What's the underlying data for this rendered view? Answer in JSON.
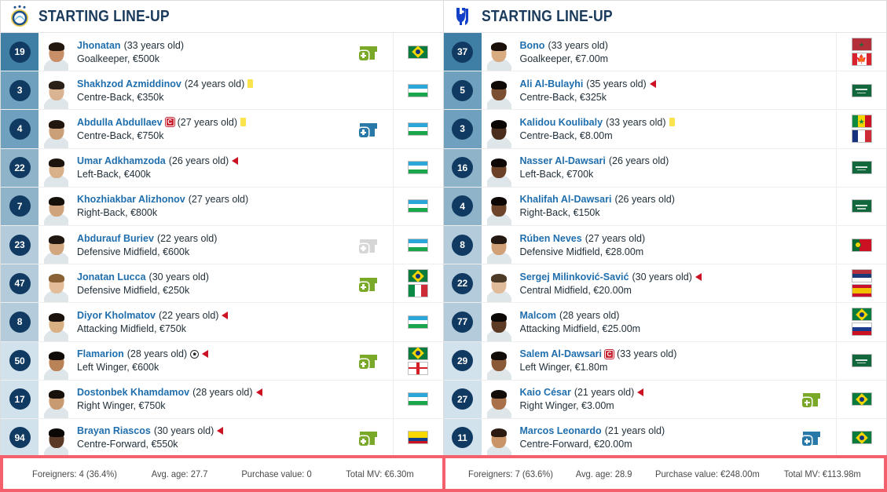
{
  "panels": [
    {
      "id": "home",
      "title": "STARTING LINE-UP",
      "crest": "club-crest-pakhtakor",
      "crest_color": "#1b4f8a",
      "players": [
        {
          "number": "19",
          "name": "Jhonatan",
          "age": "(33 years old)",
          "position": "Goalkeeper, €500k",
          "sub": "in-green",
          "sub_icon": "substitute-in-icon",
          "cards": [],
          "captain": false,
          "arrow": false,
          "goal": false,
          "flags": [
            "brazil"
          ],
          "shade": "#3f7fa6",
          "skin": "#c98f68",
          "hair": "#23180f"
        },
        {
          "number": "3",
          "name": "Shakhzod Azmiddinov",
          "age": "(24 years old)",
          "position": "Centre-Back, €350k",
          "sub": "none",
          "sub_icon": "",
          "cards": [
            "yellow"
          ],
          "captain": false,
          "arrow": false,
          "goal": false,
          "flags": [
            "uzbekistan"
          ],
          "shade": "#6fa0bd",
          "skin": "#dab393",
          "hair": "#2b2018"
        },
        {
          "number": "4",
          "name": "Abdulla Abdullaev",
          "age": "(27 years old)",
          "position": "Centre-Back, €750k",
          "sub": "in-blue",
          "sub_icon": "substitute-in-icon",
          "cards": [
            "yellow"
          ],
          "captain": true,
          "arrow": false,
          "goal": false,
          "flags": [
            "uzbekistan"
          ],
          "shade": "#6fa0bd",
          "skin": "#caa079",
          "hair": "#20160e"
        },
        {
          "number": "22",
          "name": "Umar Adkhamzoda",
          "age": "(26 years old)",
          "position": "Left-Back, €400k",
          "sub": "none",
          "sub_icon": "",
          "cards": [],
          "captain": false,
          "arrow": true,
          "goal": false,
          "flags": [
            "uzbekistan"
          ],
          "shade": "#8fb4ca",
          "skin": "#d8b08a",
          "hair": "#1d140d"
        },
        {
          "number": "7",
          "name": "Khozhiakbar Alizhonov",
          "age": "(27 years old)",
          "position": "Right-Back, €800k",
          "sub": "none",
          "sub_icon": "",
          "cards": [],
          "captain": false,
          "arrow": false,
          "goal": false,
          "flags": [
            "uzbekistan"
          ],
          "shade": "#8fb4ca",
          "skin": "#cfa47d",
          "hair": "#15100a"
        },
        {
          "number": "23",
          "name": "Abdurauf Buriev",
          "age": "(22 years old)",
          "position": "Defensive Midfield, €600k",
          "sub": "grey",
          "sub_icon": "substitute-unused-icon",
          "cards": [],
          "captain": false,
          "arrow": false,
          "goal": false,
          "flags": [
            "uzbekistan"
          ],
          "shade": "#b3cbdb",
          "skin": "#d2a67e",
          "hair": "#201711"
        },
        {
          "number": "47",
          "name": "Jonatan Lucca",
          "age": "(30 years old)",
          "position": "Defensive Midfield, €250k",
          "sub": "in-green",
          "sub_icon": "substitute-in-icon",
          "cards": [],
          "captain": false,
          "arrow": false,
          "goal": false,
          "flags": [
            "brazil",
            "italy"
          ],
          "shade": "#b3cbdb",
          "skin": "#e3bd99",
          "hair": "#8a6134"
        },
        {
          "number": "8",
          "name": "Diyor Kholmatov",
          "age": "(22 years old)",
          "position": "Attacking Midfield, €750k",
          "sub": "none",
          "sub_icon": "",
          "cards": [],
          "captain": false,
          "arrow": true,
          "goal": false,
          "flags": [
            "uzbekistan"
          ],
          "shade": "#b3cbdb",
          "skin": "#d9b083",
          "hair": "#19110b"
        },
        {
          "number": "50",
          "name": "Flamarion",
          "age": "(28 years old)",
          "position": "Left Winger, €600k",
          "sub": "in-green",
          "sub_icon": "substitute-in-icon",
          "cards": [],
          "captain": false,
          "arrow": true,
          "goal": true,
          "flags": [
            "brazil",
            "georgia"
          ],
          "shade": "#d2e2ec",
          "skin": "#b98257",
          "hair": "#120c08"
        },
        {
          "number": "17",
          "name": "Dostonbek Khamdamov",
          "age": "(28 years old)",
          "position": "Right Winger, €750k",
          "sub": "none",
          "sub_icon": "",
          "cards": [],
          "captain": false,
          "arrow": true,
          "goal": false,
          "flags": [
            "uzbekistan"
          ],
          "shade": "#d2e2ec",
          "skin": "#c79a71",
          "hair": "#18110b"
        },
        {
          "number": "94",
          "name": "Brayan Riascos",
          "age": "(30 years old)",
          "position": "Centre-Forward, €550k",
          "sub": "in-green",
          "sub_icon": "substitute-in-icon",
          "cards": [],
          "captain": false,
          "arrow": true,
          "goal": false,
          "flags": [
            "colombia"
          ],
          "shade": "#d2e2ec",
          "skin": "#5a3a27",
          "hair": "#0c0806"
        }
      ],
      "stats": [
        {
          "label": "Foreigners: 4 (36.4%)"
        },
        {
          "label": "Avg. age: 27.7"
        },
        {
          "label": "Purchase value: 0"
        },
        {
          "label": "Total MV: €6.30m"
        }
      ]
    },
    {
      "id": "away",
      "title": "STARTING LINE-UP",
      "crest": "club-crest-al-hilal",
      "crest_color": "#1340c8",
      "players": [
        {
          "number": "37",
          "name": "Bono",
          "age": "(33 years old)",
          "position": "Goalkeeper, €7.00m",
          "sub": "none",
          "sub_icon": "",
          "cards": [],
          "captain": false,
          "arrow": false,
          "goal": false,
          "flags": [
            "morocco",
            "canada"
          ],
          "shade": "#3f7fa6",
          "skin": "#d8ab81",
          "hair": "#1a1009"
        },
        {
          "number": "5",
          "name": "Ali Al-Bulayhi",
          "age": "(35 years old)",
          "position": "Centre-Back, €325k",
          "sub": "none",
          "sub_icon": "",
          "cards": [],
          "captain": false,
          "arrow": true,
          "goal": false,
          "flags": [
            "saudi-arabia"
          ],
          "shade": "#6fa0bd",
          "skin": "#7a4f32",
          "hair": "#100a06"
        },
        {
          "number": "3",
          "name": "Kalidou Koulibaly",
          "age": "(33 years old)",
          "position": "Centre-Back, €8.00m",
          "sub": "none",
          "sub_icon": "",
          "cards": [
            "yellow"
          ],
          "captain": false,
          "arrow": false,
          "goal": false,
          "flags": [
            "senegal",
            "france"
          ],
          "shade": "#6fa0bd",
          "skin": "#4a2d1c",
          "hair": "#0a0604"
        },
        {
          "number": "16",
          "name": "Nasser Al-Dawsari",
          "age": "(26 years old)",
          "position": "Left-Back, €700k",
          "sub": "none",
          "sub_icon": "",
          "cards": [],
          "captain": false,
          "arrow": false,
          "goal": false,
          "flags": [
            "saudi-arabia"
          ],
          "shade": "#8fb4ca",
          "skin": "#6b4228",
          "hair": "#0d0805"
        },
        {
          "number": "4",
          "name": "Khalifah Al-Dawsari",
          "age": "(26 years old)",
          "position": "Right-Back, €150k",
          "sub": "none",
          "sub_icon": "",
          "cards": [],
          "captain": false,
          "arrow": false,
          "goal": false,
          "flags": [
            "saudi-arabia"
          ],
          "shade": "#8fb4ca",
          "skin": "#6d452b",
          "hair": "#0c0705"
        },
        {
          "number": "8",
          "name": "Rúben Neves",
          "age": "(27 years old)",
          "position": "Defensive Midfield, €28.00m",
          "sub": "none",
          "sub_icon": "",
          "cards": [],
          "captain": false,
          "arrow": false,
          "goal": false,
          "flags": [
            "portugal"
          ],
          "shade": "#b3cbdb",
          "skin": "#d2a076",
          "hair": "#241812"
        },
        {
          "number": "22",
          "name": "Sergej Milinković-Savić",
          "age": "(30 years old)",
          "position": "Central Midfield, €20.00m",
          "sub": "none",
          "sub_icon": "",
          "cards": [],
          "captain": false,
          "arrow": true,
          "goal": false,
          "flags": [
            "serbia",
            "spain"
          ],
          "shade": "#b3cbdb",
          "skin": "#e0bb99",
          "hair": "#4d3a26"
        },
        {
          "number": "77",
          "name": "Malcom",
          "age": "(28 years old)",
          "position": "Attacking Midfield, €25.00m",
          "sub": "none",
          "sub_icon": "",
          "cards": [],
          "captain": false,
          "arrow": false,
          "goal": false,
          "flags": [
            "brazil",
            "russia"
          ],
          "shade": "#b3cbdb",
          "skin": "#5d3a24",
          "hair": "#0b0705"
        },
        {
          "number": "29",
          "name": "Salem Al-Dawsari",
          "age": "(33 years old)",
          "position": "Left Winger, €1.80m",
          "sub": "none",
          "sub_icon": "",
          "cards": [],
          "captain": true,
          "arrow": false,
          "goal": false,
          "flags": [
            "saudi-arabia"
          ],
          "shade": "#d2e2ec",
          "skin": "#8a5a38",
          "hair": "#120c08"
        },
        {
          "number": "27",
          "name": "Kaio César",
          "age": "(21 years old)",
          "position": "Right Winger, €3.00m",
          "sub": "in-green",
          "sub_icon": "substitute-in-icon",
          "cards": [],
          "captain": false,
          "arrow": true,
          "goal": false,
          "flags": [
            "brazil"
          ],
          "shade": "#d2e2ec",
          "skin": "#a8714a",
          "hair": "#120c08"
        },
        {
          "number": "11",
          "name": "Marcos Leonardo",
          "age": "(21 years old)",
          "position": "Centre-Forward, €20.00m",
          "sub": "in-blue",
          "sub_icon": "substitute-in-icon",
          "cards": [],
          "captain": false,
          "arrow": false,
          "goal": false,
          "flags": [
            "brazil"
          ],
          "shade": "#d2e2ec",
          "skin": "#c99468",
          "hair": "#2a1a10"
        }
      ],
      "stats": [
        {
          "label": "Foreigners: 7 (63.6%)"
        },
        {
          "label": "Avg. age: 28.9"
        },
        {
          "label": "Purchase value: €248.00m"
        },
        {
          "label": "Total MV: €113.98m"
        }
      ]
    }
  ]
}
